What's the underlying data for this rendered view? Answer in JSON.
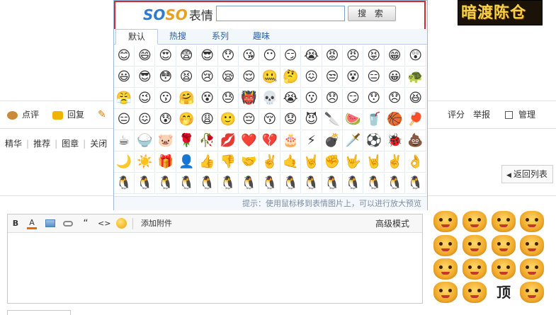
{
  "banner": {
    "text": "暗渡陈仓"
  },
  "thread_toolbar": {
    "items": [
      {
        "label": "点评",
        "icon": "comment-icon"
      },
      {
        "label": "回复",
        "icon": "reply-icon"
      },
      {
        "label": "",
        "icon": "edit-pencil-icon"
      }
    ],
    "right_items": [
      {
        "label": "评分"
      },
      {
        "label": "举报"
      },
      {
        "label": "管理",
        "icon": "checkbox-icon"
      }
    ]
  },
  "mod_links": [
    "精华",
    "推荐",
    "图章",
    "关闭"
  ],
  "back_button": {
    "label": "返回列表",
    "icon": "triangle-left-icon"
  },
  "editor": {
    "toolbar": {
      "bold": "B",
      "font_color": "A",
      "image_icon": "image-icon",
      "link_icon": "link-icon",
      "quote": "“",
      "code": "<>",
      "smiley_icon": "smiley-icon",
      "attach": "添加附件",
      "advanced": "高级模式"
    }
  },
  "stickers": {
    "text_sticker": "顶"
  },
  "emoji_popup": {
    "logo": {
      "part1": "SO",
      "part2": "SO",
      "cn": "表情"
    },
    "search": {
      "value": "",
      "button": "搜 索"
    },
    "tabs": [
      "默认",
      "热搜",
      "系列",
      "趣味"
    ],
    "active_tab": "默认",
    "hint": "提示：使用鼠标移到表情图片上，可以进行放大预览",
    "emoji_rows": [
      [
        "😊",
        "😄",
        "😍",
        "😨",
        "😎",
        "😯",
        "😘",
        "😶",
        "😏",
        "😭",
        "😡",
        "😠",
        "😝",
        "😁",
        "😲"
      ],
      [
        "😃",
        "😎",
        "😳",
        "😫",
        "😢",
        "😪",
        "😌",
        "🤐",
        "🤔",
        "😖",
        "😒",
        "😵",
        "😑",
        "😀",
        "🐢"
      ],
      [
        "😤",
        "😉",
        "😗",
        "🤗",
        "😵",
        "😓",
        "👹",
        "💀",
        "😭",
        "😗",
        "😞",
        "😏",
        "😯",
        "😞",
        "😆"
      ],
      [
        "😑",
        "😖",
        "😰",
        "🤭",
        "😩",
        "🙂",
        "😔",
        "😚",
        "😟",
        "😈",
        "🔪",
        "🍉",
        "🥤",
        "🏀",
        "🏓"
      ],
      [
        "☕",
        "🍚",
        "🐷",
        "🌹",
        "🥀",
        "💋",
        "❤️",
        "💔",
        "🎂",
        "⚡",
        "💣",
        "🗡️",
        "⚽",
        "🐞",
        "💩"
      ],
      [
        "🌙",
        "☀️",
        "🎁",
        "👤",
        "👍",
        "👎",
        "🤝",
        "✌️",
        "🤙",
        "🤘",
        "✊",
        "🤟",
        "🤘",
        "✌️",
        "👌"
      ],
      [
        "🐧",
        "🐧",
        "🐧",
        "🐧",
        "🐧",
        "🐧",
        "🐧",
        "🐧",
        "🐧",
        "🐧",
        "🐧",
        "🐧",
        "🐧",
        "🐧",
        "🐧"
      ]
    ]
  },
  "colors": {
    "popup_border": "#9ab8d7",
    "search_highlight": "#d6282f",
    "tab_text": "#2b5fa0",
    "logo_blue": "#2d7cd0",
    "logo_orange": "#e8a11b"
  }
}
